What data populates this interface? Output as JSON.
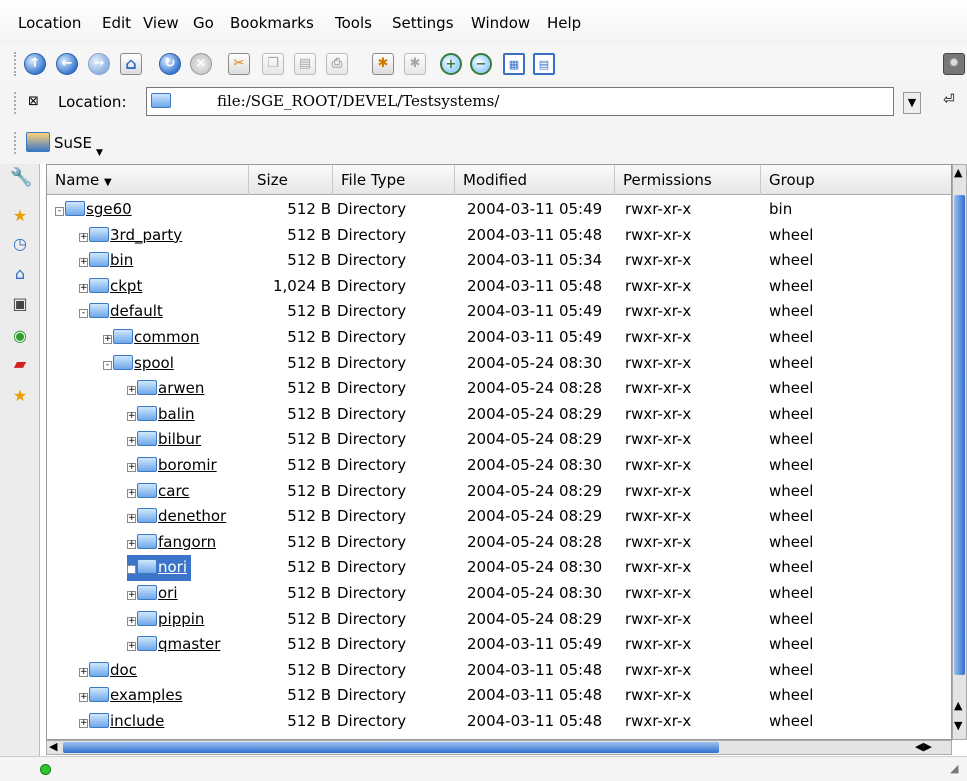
{
  "menu": [
    "Location",
    "Edit",
    "View",
    "Go",
    "Bookmarks",
    "Tools",
    "Settings",
    "Window",
    "Help"
  ],
  "location": {
    "label": "Location:",
    "value": "file:/SGE_ROOT/DEVEL/Testsystems/"
  },
  "bookmark": {
    "label": "SuSE"
  },
  "columns": [
    "Name",
    "Size",
    "File Type",
    "Modified",
    "Permissions",
    "Group"
  ],
  "rows": [
    {
      "name": "sge60",
      "size": "512 B",
      "type": "Directory",
      "modified": "2004-03-11 05:49",
      "perm": "rwxr-xr-x",
      "group": "bin"
    },
    {
      "name": "3rd_party",
      "size": "512 B",
      "type": "Directory",
      "modified": "2004-03-11 05:48",
      "perm": "rwxr-xr-x",
      "group": "wheel"
    },
    {
      "name": "bin",
      "size": "512 B",
      "type": "Directory",
      "modified": "2004-03-11 05:34",
      "perm": "rwxr-xr-x",
      "group": "wheel"
    },
    {
      "name": "ckpt",
      "size": "1,024 B",
      "type": "Directory",
      "modified": "2004-03-11 05:48",
      "perm": "rwxr-xr-x",
      "group": "wheel"
    },
    {
      "name": "default",
      "size": "512 B",
      "type": "Directory",
      "modified": "2004-03-11 05:49",
      "perm": "rwxr-xr-x",
      "group": "wheel"
    },
    {
      "name": "common",
      "size": "512 B",
      "type": "Directory",
      "modified": "2004-03-11 05:49",
      "perm": "rwxr-xr-x",
      "group": "wheel"
    },
    {
      "name": "spool",
      "size": "512 B",
      "type": "Directory",
      "modified": "2004-05-24 08:30",
      "perm": "rwxr-xr-x",
      "group": "wheel"
    },
    {
      "name": "arwen",
      "size": "512 B",
      "type": "Directory",
      "modified": "2004-05-24 08:28",
      "perm": "rwxr-xr-x",
      "group": "wheel"
    },
    {
      "name": "balin",
      "size": "512 B",
      "type": "Directory",
      "modified": "2004-05-24 08:29",
      "perm": "rwxr-xr-x",
      "group": "wheel"
    },
    {
      "name": "bilbur",
      "size": "512 B",
      "type": "Directory",
      "modified": "2004-05-24 08:29",
      "perm": "rwxr-xr-x",
      "group": "wheel"
    },
    {
      "name": "boromir",
      "size": "512 B",
      "type": "Directory",
      "modified": "2004-05-24 08:30",
      "perm": "rwxr-xr-x",
      "group": "wheel"
    },
    {
      "name": "carc",
      "size": "512 B",
      "type": "Directory",
      "modified": "2004-05-24 08:29",
      "perm": "rwxr-xr-x",
      "group": "wheel"
    },
    {
      "name": "denethor",
      "size": "512 B",
      "type": "Directory",
      "modified": "2004-05-24 08:29",
      "perm": "rwxr-xr-x",
      "group": "wheel"
    },
    {
      "name": "fangorn",
      "size": "512 B",
      "type": "Directory",
      "modified": "2004-05-24 08:28",
      "perm": "rwxr-xr-x",
      "group": "wheel"
    },
    {
      "name": "nori",
      "size": "512 B",
      "type": "Directory",
      "modified": "2004-05-24 08:30",
      "perm": "rwxr-xr-x",
      "group": "wheel",
      "selected": true
    },
    {
      "name": "ori",
      "size": "512 B",
      "type": "Directory",
      "modified": "2004-05-24 08:30",
      "perm": "rwxr-xr-x",
      "group": "wheel"
    },
    {
      "name": "pippin",
      "size": "512 B",
      "type": "Directory",
      "modified": "2004-05-24 08:29",
      "perm": "rwxr-xr-x",
      "group": "wheel"
    },
    {
      "name": "qmaster",
      "size": "512 B",
      "type": "Directory",
      "modified": "2004-03-11 05:49",
      "perm": "rwxr-xr-x",
      "group": "wheel"
    },
    {
      "name": "doc",
      "size": "512 B",
      "type": "Directory",
      "modified": "2004-03-11 05:48",
      "perm": "rwxr-xr-x",
      "group": "wheel"
    },
    {
      "name": "examples",
      "size": "512 B",
      "type": "Directory",
      "modified": "2004-03-11 05:48",
      "perm": "rwxr-xr-x",
      "group": "wheel"
    },
    {
      "name": "include",
      "size": "512 B",
      "type": "Directory",
      "modified": "2004-03-11 05:48",
      "perm": "rwxr-xr-x",
      "group": "wheel"
    }
  ],
  "colors": {
    "selection": "#3b74c8",
    "folder": "#6ea8e8",
    "scroll": "#2f6fd0"
  },
  "icons": {
    "toolbar": [
      "up-icon",
      "back-icon",
      "forward-icon",
      "home-icon",
      "reload-icon",
      "stop-icon",
      "cut-icon",
      "copy-icon",
      "paste-icon",
      "print-icon",
      "settings-icon",
      "security-icon",
      "zoom-in-icon",
      "zoom-out-icon",
      "icon-view-icon",
      "tree-view-icon"
    ]
  }
}
